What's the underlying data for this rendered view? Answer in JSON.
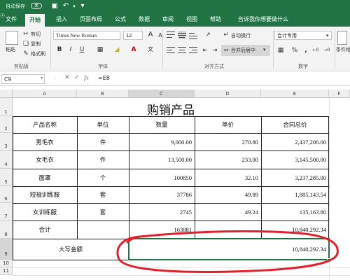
{
  "titlebar": {
    "autosave_label": "自动保存",
    "autosave_state": "关"
  },
  "menu": {
    "tabs": [
      "文件",
      "开始",
      "插入",
      "页面布局",
      "公式",
      "数据",
      "审阅",
      "视图",
      "帮助"
    ],
    "active_tab": "开始",
    "tell_me": "告诉我你想要做什么"
  },
  "ribbon": {
    "clipboard": {
      "paste": "粘贴",
      "cut": "剪切",
      "copy": "复制",
      "format_painter": "格式刷",
      "group": "剪贴板"
    },
    "font": {
      "name": "Times New Roman",
      "size": "12",
      "group": "字体",
      "bold": "B",
      "italic": "I",
      "underline": "U"
    },
    "alignment": {
      "wrap": "自动换行",
      "merge": "合并后居中",
      "group": "对齐方式"
    },
    "number": {
      "format": "会计专用",
      "group": "数字"
    },
    "styles": {
      "conditional": "条件格"
    }
  },
  "formula_bar": {
    "name_box": "C9",
    "fx": "fx",
    "formula": "=E8"
  },
  "sheet": {
    "columns": [
      "A",
      "B",
      "C",
      "D",
      "E",
      "F"
    ],
    "rows": [
      "1",
      "2",
      "3",
      "4",
      "5",
      "6",
      "7",
      "8",
      "9",
      "10",
      "11"
    ],
    "title": "购销产品",
    "headers": [
      "产品名称",
      "单位",
      "数量",
      "单价",
      "合同总价"
    ],
    "data_rows": [
      {
        "name": "男毛衣",
        "unit": "件",
        "qty": "9,000.00",
        "price": "270.80",
        "total": "2,437,200.00"
      },
      {
        "name": "女毛衣",
        "unit": "件",
        "qty": "13,500.00",
        "price": "233.00",
        "total": "3,145,500.00"
      },
      {
        "name": "面罩",
        "unit": "个",
        "qty": "100850",
        "price": "32.10",
        "total": "3,237,285.00"
      },
      {
        "name": "短袖训练服",
        "unit": "套",
        "qty": "37786",
        "price": "49.89",
        "total": "1,885,143.54"
      },
      {
        "name": "女训练服",
        "unit": "套",
        "qty": "2745",
        "price": "49.24",
        "total": "135,163.80"
      }
    ],
    "total_row": {
      "label": "合计",
      "qty": "163881",
      "total": "10,840,292.34"
    },
    "uppercase_row": {
      "label": "大写金额",
      "value": "10,840,292.34"
    }
  },
  "colors": {
    "excel_green": "#217346",
    "annotation_red": "#e0202a",
    "selection_green": "#217346"
  }
}
